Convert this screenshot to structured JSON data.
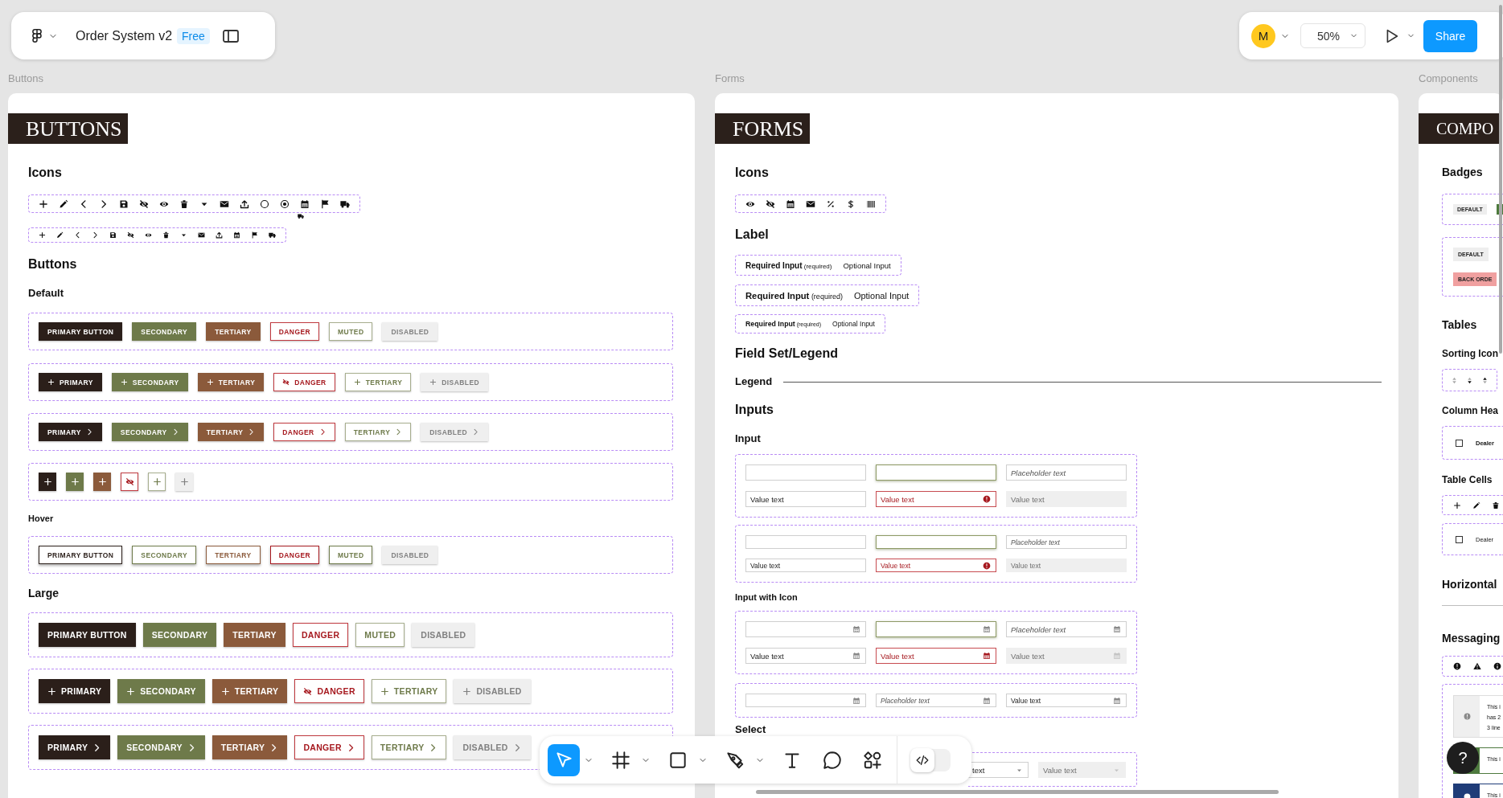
{
  "top_bar": {
    "file_name": "Order System v2",
    "plan_badge": "Free",
    "avatar_initial": "M",
    "zoom": "50%",
    "share": "Share"
  },
  "buttons_frame": {
    "frame_label": "Buttons",
    "title": "BUTTONS",
    "blocks": [
      {
        "kind": "heading",
        "text": "Icons"
      },
      {
        "kind": "icon_row_large",
        "items": [
          {
            "kind": "plus"
          },
          {
            "kind": "pencil"
          },
          {
            "kind": "chev-left"
          },
          {
            "kind": "chev-right"
          },
          {
            "kind": "save"
          },
          {
            "kind": "eye-off"
          },
          {
            "kind": "eye"
          },
          {
            "kind": "trash"
          },
          {
            "kind": "caret"
          },
          {
            "kind": "envelope"
          },
          {
            "kind": "upload"
          },
          {
            "kind": "circle"
          },
          {
            "kind": "radio"
          },
          {
            "kind": "calendar"
          },
          {
            "kind": "flag"
          },
          {
            "kind": "truck"
          }
        ],
        "extra_icon": {
          "kind": "truck"
        }
      },
      {
        "kind": "icon_row_small",
        "items": [
          {
            "kind": "plus"
          },
          {
            "kind": "pencil"
          },
          {
            "kind": "chev-left"
          },
          {
            "kind": "chev-right"
          },
          {
            "kind": "save"
          },
          {
            "kind": "eye-off"
          },
          {
            "kind": "eye"
          },
          {
            "kind": "trash"
          },
          {
            "kind": "caret"
          },
          {
            "kind": "envelope"
          },
          {
            "kind": "upload"
          },
          {
            "kind": "calendar"
          },
          {
            "kind": "flag"
          },
          {
            "kind": "truck"
          }
        ]
      },
      {
        "kind": "heading",
        "text": "Buttons"
      },
      {
        "kind": "subheading",
        "text": "Default"
      },
      {
        "kind": "button_row_small",
        "items": [
          {
            "kind": "primary",
            "label": "PRIMARY BUTTON"
          },
          {
            "kind": "secondary",
            "label": "SECONDARY"
          },
          {
            "kind": "tertiary",
            "label": "TERTIARY"
          },
          {
            "kind": "danger",
            "label": "DANGER"
          },
          {
            "kind": "muted",
            "label": "MUTED"
          },
          {
            "kind": "disabled",
            "label": "DISABLED"
          }
        ]
      },
      {
        "kind": "button_row_small",
        "items": [
          {
            "kind": "primary",
            "label": "PRIMARY",
            "icon": {
              "kind": "plus"
            }
          },
          {
            "kind": "secondary",
            "label": "SECONDARY",
            "icon": {
              "kind": "plus"
            }
          },
          {
            "kind": "tertiary",
            "label": "TERTIARY",
            "icon": {
              "kind": "plus"
            }
          },
          {
            "kind": "danger",
            "label": "DANGER",
            "icon": {
              "kind": "eye-off"
            }
          },
          {
            "kind": "muted",
            "label": "TERTIARY",
            "icon": {
              "kind": "plus"
            }
          },
          {
            "kind": "disabled",
            "label": "DISABLED",
            "icon": {
              "kind": "plus"
            }
          }
        ]
      },
      {
        "kind": "button_row_small",
        "items": [
          {
            "kind": "primary",
            "label": "PRIMARY",
            "end_icon": {
              "kind": "chev-right"
            }
          },
          {
            "kind": "secondary",
            "label": "SECONDARY",
            "end_icon": {
              "kind": "chev-right"
            }
          },
          {
            "kind": "tertiary",
            "label": "TERTIARY",
            "end_icon": {
              "kind": "chev-right"
            }
          },
          {
            "kind": "danger",
            "label": "DANGER",
            "end_icon": {
              "kind": "chev-right"
            }
          },
          {
            "kind": "muted",
            "label": "TERTIARY",
            "end_icon": {
              "kind": "chev-right"
            }
          },
          {
            "kind": "disabled",
            "label": "DISABLED",
            "end_icon": {
              "kind": "chev-right"
            }
          }
        ]
      },
      {
        "kind": "button_row_small",
        "items": [
          {
            "kind": "primary",
            "icon": {
              "kind": "plus"
            }
          },
          {
            "kind": "secondary",
            "icon": {
              "kind": "plus"
            }
          },
          {
            "kind": "tertiary",
            "icon": {
              "kind": "plus"
            }
          },
          {
            "kind": "danger",
            "icon": {
              "kind": "eye-off"
            }
          },
          {
            "kind": "muted",
            "icon": {
              "kind": "plus"
            }
          },
          {
            "kind": "disabled",
            "icon": {
              "kind": "plus"
            }
          }
        ]
      },
      {
        "kind": "caption",
        "text": "Hover"
      },
      {
        "kind": "button_row_hover",
        "items": [
          {
            "kind": "primary",
            "label": "PRIMARY BUTTON"
          },
          {
            "kind": "secondary",
            "label": "SECONDARY"
          },
          {
            "kind": "tertiary",
            "label": "TERTIARY"
          },
          {
            "kind": "danger",
            "label": "DANGER"
          },
          {
            "kind": "muted",
            "label": "MUTED"
          },
          {
            "kind": "disabled",
            "label": "DISABLED"
          }
        ]
      },
      {
        "kind": "heading_small",
        "text": "Large"
      },
      {
        "kind": "button_row_large",
        "items": [
          {
            "kind": "primary",
            "label": "PRIMARY BUTTON"
          },
          {
            "kind": "secondary",
            "label": "SECONDARY"
          },
          {
            "kind": "tertiary",
            "label": "TERTIARY"
          },
          {
            "kind": "danger",
            "label": "DANGER"
          },
          {
            "kind": "muted",
            "label": "MUTED"
          },
          {
            "kind": "disabled",
            "label": "DISABLED"
          }
        ]
      },
      {
        "kind": "button_row_large",
        "items": [
          {
            "kind": "primary",
            "label": "PRIMARY",
            "icon": {
              "kind": "plus"
            }
          },
          {
            "kind": "secondary",
            "label": "SECONDARY",
            "icon": {
              "kind": "plus"
            }
          },
          {
            "kind": "tertiary",
            "label": "TERTIARY",
            "icon": {
              "kind": "plus"
            }
          },
          {
            "kind": "danger",
            "label": "DANGER",
            "icon": {
              "kind": "eye-off"
            }
          },
          {
            "kind": "muted",
            "label": "TERTIARY",
            "icon": {
              "kind": "plus"
            }
          },
          {
            "kind": "disabled",
            "label": "DISABLED",
            "icon": {
              "kind": "plus"
            }
          }
        ]
      },
      {
        "kind": "button_row_large",
        "items": [
          {
            "kind": "primary",
            "label": "PRIMARY",
            "end_icon": {
              "kind": "chev-right"
            }
          },
          {
            "kind": "secondary",
            "label": "SECONDARY",
            "end_icon": {
              "kind": "chev-right"
            }
          },
          {
            "kind": "tertiary",
            "label": "TERTIARY",
            "end_icon": {
              "kind": "chev-right"
            }
          },
          {
            "kind": "danger",
            "label": "DANGER",
            "end_icon": {
              "kind": "chev-right"
            }
          },
          {
            "kind": "muted",
            "label": "TERTIARY",
            "end_icon": {
              "kind": "chev-right"
            }
          },
          {
            "kind": "disabled",
            "label": "DISABLED",
            "end_icon": {
              "kind": "chev-right"
            }
          }
        ]
      }
    ]
  },
  "forms_frame": {
    "frame_label": "Forms",
    "title": "FORMS",
    "blocks": [
      {
        "kind": "heading",
        "text": "Icons"
      },
      {
        "kind": "icon_row_large",
        "items": [
          {
            "kind": "eye"
          },
          {
            "kind": "eye-off"
          },
          {
            "kind": "calendar"
          },
          {
            "kind": "envelope"
          },
          {
            "kind": "percent"
          },
          {
            "kind": "dollar"
          },
          {
            "kind": "barcode"
          }
        ]
      },
      {
        "kind": "heading",
        "text": "Label"
      },
      {
        "kind": "label_medium",
        "required": "**Required Input** (required)",
        "optional": "Optional Input"
      },
      {
        "kind": "label_large",
        "required": "**Required Input** (required)",
        "optional": "Optional Input"
      },
      {
        "kind": "label_small",
        "required": "**Required Input** (required)",
        "optional": "Optional Input"
      },
      {
        "kind": "heading",
        "text": "Field Set/Legend"
      },
      {
        "kind": "legend",
        "text": "Legend"
      },
      {
        "kind": "heading",
        "text": "Inputs"
      },
      {
        "kind": "subheading",
        "text": "Input"
      },
      {
        "kind": "fields_large",
        "rows": [
          [
            {
              "kind": "default"
            },
            {
              "kind": "focus"
            },
            {
              "kind": "default",
              "placeholder": "Placeholder text"
            }
          ],
          [
            {
              "kind": "default",
              "value": "Value text"
            },
            {
              "kind": "error",
              "value": "Value text",
              "icon": {
                "kind": "alert"
              }
            },
            {
              "kind": "disabled",
              "value": "Value text"
            }
          ]
        ]
      },
      {
        "kind": "fields_small",
        "rows": [
          [
            {
              "kind": "default"
            },
            {
              "kind": "focus"
            },
            {
              "kind": "default",
              "placeholder": "Placeholder text"
            }
          ],
          [
            {
              "kind": "default",
              "value": "Value text"
            },
            {
              "kind": "error",
              "value": "Value text",
              "icon": {
                "kind": "alert"
              }
            },
            {
              "kind": "disabled",
              "value": "Value text"
            }
          ]
        ]
      },
      {
        "kind": "caption",
        "text": "Input with Icon"
      },
      {
        "kind": "fields_large",
        "rows": [
          [
            {
              "kind": "default",
              "icon": {
                "kind": "calendar"
              }
            },
            {
              "kind": "focus",
              "icon": {
                "kind": "calendar"
              }
            },
            {
              "kind": "default",
              "placeholder": "Placeholder text",
              "icon": {
                "kind": "calendar"
              }
            }
          ],
          [
            {
              "kind": "default",
              "value": "Value text",
              "icon": {
                "kind": "calendar"
              }
            },
            {
              "kind": "error",
              "value": "Value text",
              "icon": {
                "kind": "calendar"
              }
            },
            {
              "kind": "disabled",
              "value": "Value text",
              "icon": {
                "kind": "calendar"
              }
            }
          ]
        ]
      },
      {
        "kind": "fields_small",
        "rows": [
          [
            {
              "kind": "default",
              "icon": {
                "kind": "calendar"
              }
            },
            {
              "kind": "default",
              "placeholder": "Placeholder text",
              "icon": {
                "kind": "calendar"
              }
            },
            {
              "kind": "default",
              "value": "Value text",
              "icon": {
                "kind": "calendar"
              }
            }
          ]
        ]
      },
      {
        "kind": "subheading",
        "text": "Select"
      },
      {
        "kind": "fields_select",
        "rows": [
          [
            {
              "kind": "default",
              "value": "text",
              "icon": {
                "kind": "caret"
              }
            },
            {
              "kind": "disabled",
              "value": "Value text",
              "icon": {
                "kind": "caret"
              }
            }
          ]
        ]
      }
    ]
  },
  "components_frame": {
    "frame_label": "Components",
    "title": "COMPO",
    "blocks": [
      {
        "kind": "heading",
        "text": "Badges"
      },
      {
        "kind": "badge_row",
        "items": [
          {
            "label": "DEFAULT",
            "color": "#eeeeee"
          },
          {
            "color": "#4d7a3c"
          }
        ]
      },
      {
        "kind": "badge_column",
        "items": [
          {
            "label": "DEFAULT",
            "color": "#eeeeee"
          },
          {
            "label": "BACK ORDE",
            "color": "#f0a0a0"
          }
        ]
      },
      {
        "kind": "heading",
        "text": "Tables"
      },
      {
        "kind": "subheading",
        "text": "Sorting Icon"
      },
      {
        "kind": "icon_row_sort",
        "items": [
          {
            "kind": "sort-none"
          },
          {
            "kind": "sort-desc"
          },
          {
            "kind": "sort-asc"
          }
        ]
      },
      {
        "kind": "subheading",
        "text": "Column Hea"
      },
      {
        "kind": "header_row",
        "checked": false,
        "label": "Dealer"
      },
      {
        "kind": "subheading",
        "text": "Table Cells"
      },
      {
        "kind": "icon_row_cell",
        "items": [
          {
            "kind": "plus"
          },
          {
            "kind": "pencil"
          },
          {
            "kind": "trash"
          }
        ]
      },
      {
        "kind": "cell_row",
        "checked": false,
        "label": "Dealer"
      },
      {
        "kind": "heading",
        "text": "Horizontal"
      },
      {
        "kind": "rule"
      },
      {
        "kind": "heading",
        "text": "Messaging"
      },
      {
        "kind": "icon_row_message",
        "items": [
          {
            "kind": "alert"
          },
          {
            "kind": "warning"
          },
          {
            "kind": "info"
          }
        ]
      },
      {
        "kind": "messages",
        "items": [
          {
            "kind": "neutral",
            "lines": [
              "This i",
              "has 2",
              "3 line"
            ]
          },
          {
            "kind": "success",
            "lines": [
              "This i"
            ]
          },
          {
            "kind": "info",
            "lines": [
              "This i"
            ]
          }
        ]
      }
    ]
  },
  "toolbar": {
    "tools": [
      {
        "kind": "move",
        "selected": true,
        "menu": true
      },
      {
        "kind": "frame",
        "selected": false,
        "menu": true
      },
      {
        "kind": "rectangle",
        "selected": false,
        "menu": true
      },
      {
        "kind": "pen",
        "selected": false,
        "menu": true
      },
      {
        "kind": "text",
        "selected": false,
        "menu": false
      },
      {
        "kind": "comment",
        "selected": false,
        "menu": false
      },
      {
        "kind": "shapes",
        "selected": false,
        "menu": false
      }
    ],
    "dev_mode": {
      "on": false
    }
  },
  "help": "?"
}
